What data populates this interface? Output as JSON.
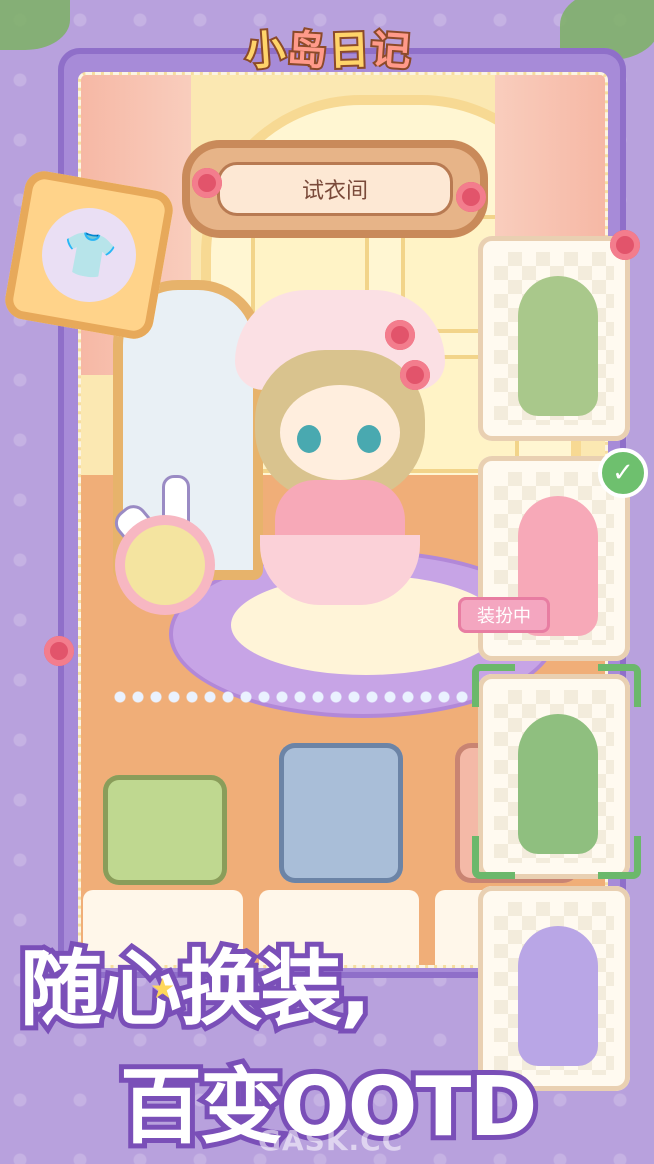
{
  "logo": {
    "chars": [
      "小",
      "岛",
      "日",
      "记"
    ]
  },
  "room": {
    "title": "试衣间"
  },
  "outfit_panel": {
    "hanger_icon": "shirt-hanger-icon"
  },
  "outfit_cards": [
    {
      "id": "green",
      "color": "#a9c88b"
    },
    {
      "id": "pink",
      "color": "#f7a9b8",
      "equipped": true,
      "badge": "装扮中"
    },
    {
      "id": "gent",
      "color": "#8fbf7f",
      "selected": true
    },
    {
      "id": "lilac",
      "color": "#b9a6e6"
    }
  ],
  "slogan": {
    "line1": "随心换装,",
    "line2": "百变OOTD"
  },
  "watermark": "GASK.CC",
  "colors": {
    "accent": "#7a4fb8",
    "panel": "#a78bd8",
    "check": "#6ec06e"
  }
}
